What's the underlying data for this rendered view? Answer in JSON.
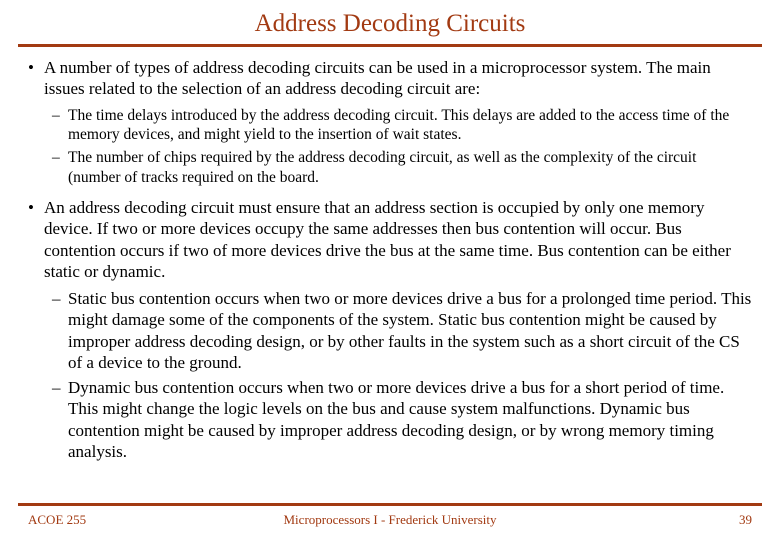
{
  "title": "Address Decoding Circuits",
  "bullets": {
    "b1a": "A number of types of address decoding circuits can be used in a microprocessor system. The main issues related to the selection of an address decoding circuit are:",
    "b1a_s1": "The time delays introduced by the address decoding circuit. This delays are added to the access time of the memory devices, and might yield to the insertion of wait states.",
    "b1a_s2": "The number of chips required by the address decoding circuit, as well as the complexity of the circuit (number of tracks required on the board.",
    "b1b": "An address decoding circuit must ensure that an address section is occupied by only one memory device. If two or more devices occupy the same addresses then bus contention will occur. Bus contention occurs if two of more devices drive the bus at the same time. Bus contention can be either static or dynamic.",
    "b1b_s1": "Static bus contention occurs when two or more devices drive a bus for a prolonged time period. This might damage some of the components of the system. Static bus contention might be caused by improper address decoding design, or by other faults in the system such as a short circuit of the CS of a device to the ground.",
    "b1b_s2": "Dynamic bus contention occurs when two or more devices drive a bus for a short period of time. This might change the logic levels on the bus and cause system malfunctions. Dynamic bus contention might be caused by improper address decoding design, or by wrong memory timing analysis."
  },
  "footer": {
    "left": "ACOE 255",
    "center": "Microprocessors I - Frederick University",
    "right": "39"
  },
  "colors": {
    "accent": "#a23a12"
  }
}
